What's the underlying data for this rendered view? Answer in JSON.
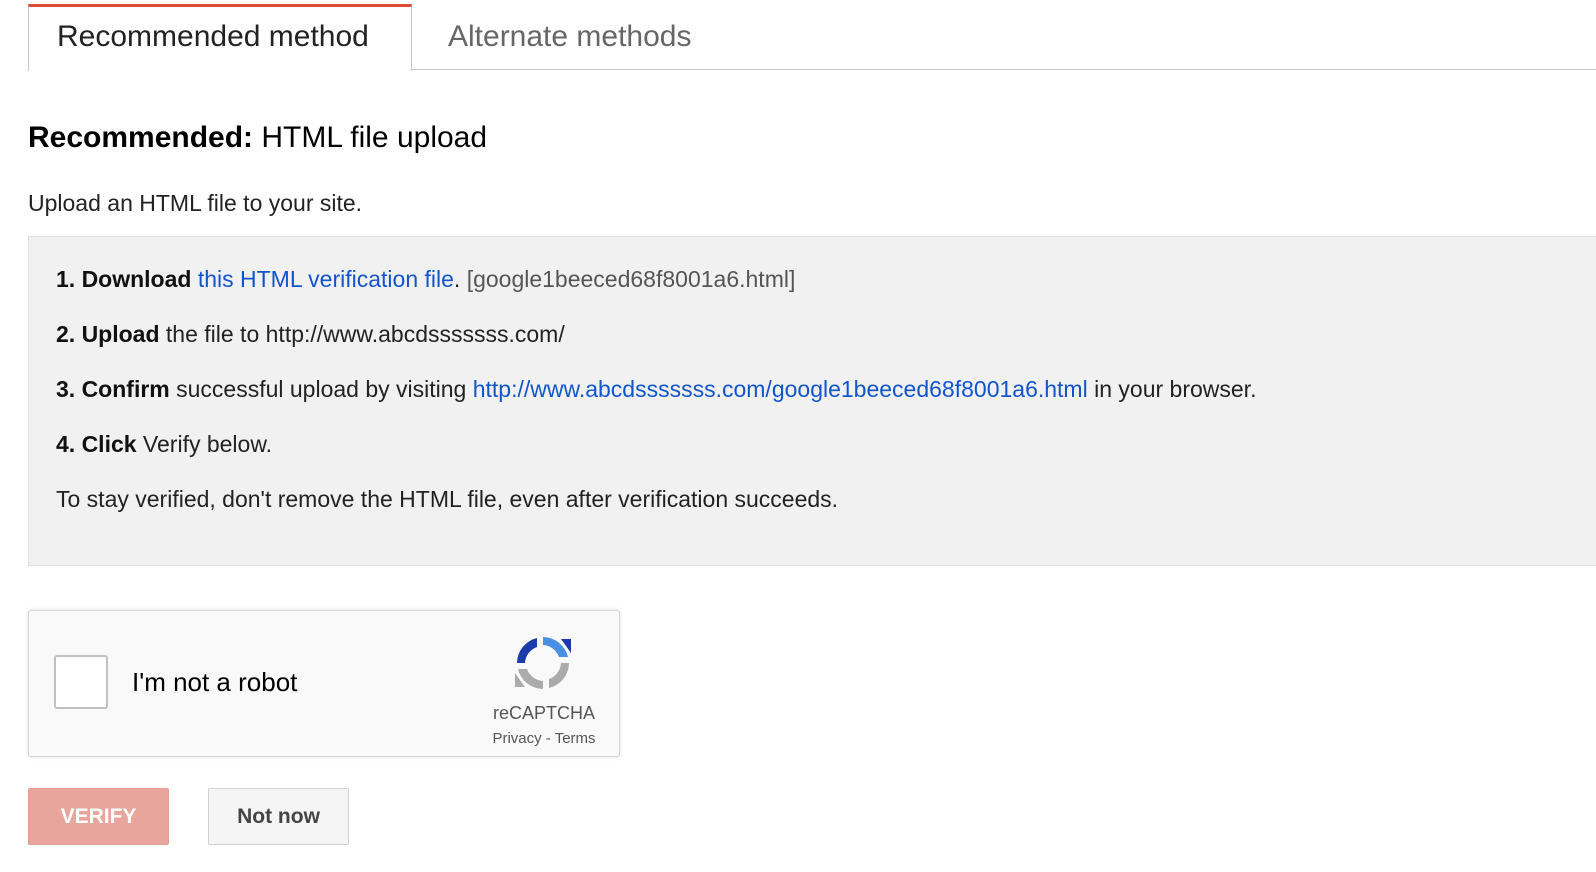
{
  "tabs": {
    "recommended_label": "Recommended method",
    "alternate_label": "Alternate methods",
    "active_color": "#dd4b39"
  },
  "heading": {
    "bold": "Recommended:",
    "rest": " HTML file upload"
  },
  "subtext": "Upload an HTML file to your site.",
  "steps": {
    "step1": {
      "bold": "1. Download",
      "sep_before": " ",
      "link": "this HTML verification file",
      "sep_after": ". ",
      "filename": "[google1beeced68f8001a6.html]"
    },
    "step2": {
      "bold": "2. Upload",
      "text": " the file to http://www.abcdsssssss.com/"
    },
    "step3": {
      "bold": "3. Confirm",
      "text_before": " successful upload by visiting ",
      "link": "http://www.abcdsssssss.com/google1beeced68f8001a6.html",
      "text_after": " in your browser."
    },
    "step4": {
      "bold": "4. Click",
      "text": " Verify below."
    },
    "note": "To stay verified, don't remove the HTML file, even after verification succeeds."
  },
  "captcha": {
    "label": "I'm not a robot",
    "brand": "reCAPTCHA",
    "privacy": "Privacy",
    "separator": " - ",
    "terms": "Terms",
    "icon": "recaptcha-logo-icon"
  },
  "buttons": {
    "verify_label": "VERIFY",
    "not_now_label": "Not now",
    "verify_color": "#e8a59c"
  },
  "colors": {
    "link": "#1155cc",
    "box_background": "#f1f1f1"
  }
}
